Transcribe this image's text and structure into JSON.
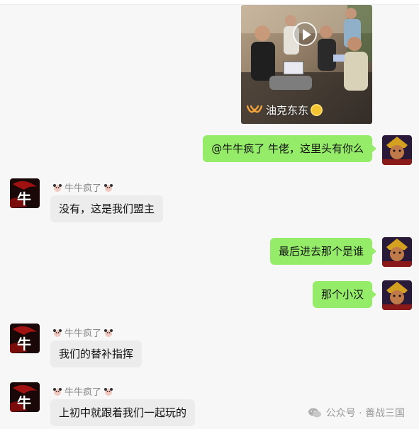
{
  "video_card": {
    "channel_name": "油克东东",
    "play_icon": "play-icon",
    "logo_icon": "channel-logo-icon"
  },
  "messages": [
    {
      "side": "out",
      "text": "@牛牛疯了 牛佬，这里头有你么"
    },
    {
      "side": "in",
      "sender": "牛牛疯了",
      "text": "没有，这是我们盟主"
    },
    {
      "side": "out",
      "text": "最后进去那个是谁"
    },
    {
      "side": "out",
      "text": "那个小汉"
    },
    {
      "side": "in",
      "sender": "牛牛疯了",
      "text": "我们的替补指挥"
    },
    {
      "side": "in",
      "sender": "牛牛疯了",
      "text": "上初中就跟着我们一起玩的"
    }
  ],
  "avatars": {
    "self": "warrior-avatar-icon",
    "other": "niu-avatar-icon",
    "other_char": "牛"
  },
  "watermark": {
    "text": "公众号 · 善战三国",
    "icon": "wechat-icon"
  },
  "colors": {
    "out_bubble": "#95ec69",
    "in_bubble": "#ececec",
    "background": "#f7f7f8"
  }
}
